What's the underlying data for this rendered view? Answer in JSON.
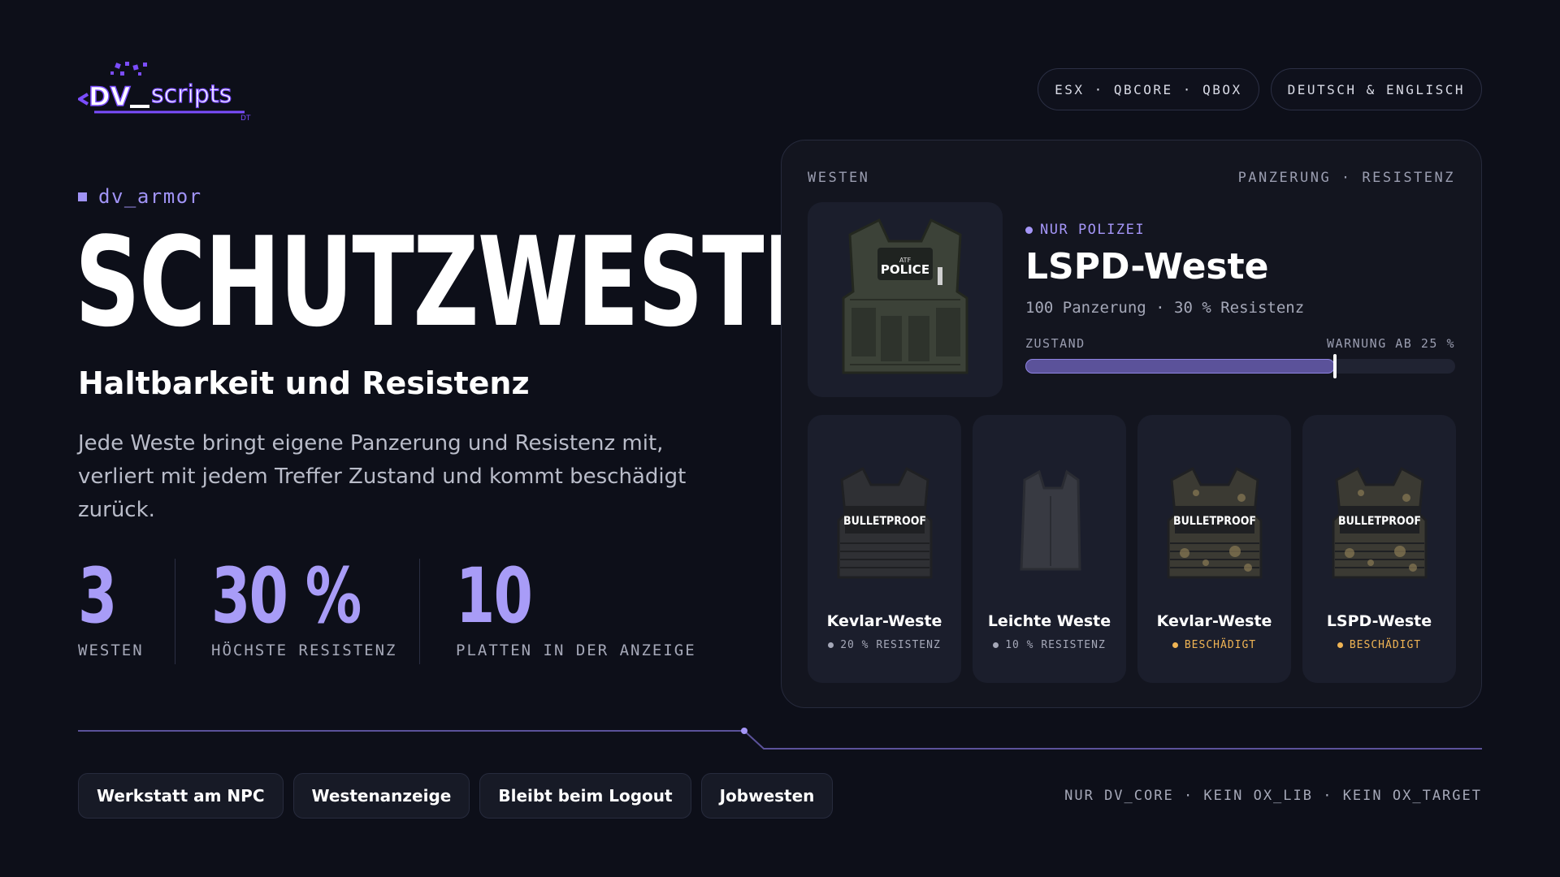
{
  "brand": {
    "logo_text": "DV_scripts",
    "accent": "#a596f8"
  },
  "top_pills": [
    "ESX · QBCORE · QBOX",
    "DEUTSCH & ENGLISCH"
  ],
  "hero": {
    "tag": "dv_armor",
    "title": "SCHUTZWESTEN",
    "subtitle": "Haltbarkeit und Resistenz",
    "description": "Jede Weste bringt eigene Panzerung und Resistenz mit, verliert mit jedem Treffer Zustand und kommt beschädigt zurück."
  },
  "stats": [
    {
      "value": "3",
      "label": "WESTEN"
    },
    {
      "value": "30 %",
      "label": "HÖCHSTE RESISTENZ"
    },
    {
      "value": "10",
      "label": "PLATTEN IN DER ANZEIGE"
    }
  ],
  "panel": {
    "header_left": "WESTEN",
    "header_right": "PANZERUNG · RESISTENZ",
    "featured": {
      "badge": "NUR POLIZEI",
      "title": "LSPD-Weste",
      "stats_line": "100 Panzerung · 30 % Resistenz",
      "bar_label_left": "ZUSTAND",
      "bar_label_right": "WARNUNG AB 25 %",
      "condition_fraction": 0.72,
      "vest_text": "POLICE",
      "vest_small_text": "ATF"
    },
    "cards": [
      {
        "name": "Kevlar-Weste",
        "status": "20 % RESISTENZ",
        "warn": false,
        "vest_label": "BULLETPROOF",
        "style": "black"
      },
      {
        "name": "Leichte Weste",
        "status": "10 % RESISTENZ",
        "warn": false,
        "vest_label": "",
        "style": "light"
      },
      {
        "name": "Kevlar-Weste",
        "status": "BESCHÄDIGT",
        "warn": true,
        "vest_label": "BULLETPROOF",
        "style": "damaged"
      },
      {
        "name": "LSPD-Weste",
        "status": "BESCHÄDIGT",
        "warn": true,
        "vest_label": "BULLETPROOF",
        "style": "damaged"
      }
    ]
  },
  "chips": [
    "Werkstatt am NPC",
    "Westenanzeige",
    "Bleibt beim Logout",
    "Jobwesten"
  ],
  "footer_note": "NUR DV_CORE · KEIN OX_LIB · KEIN OX_TARGET"
}
